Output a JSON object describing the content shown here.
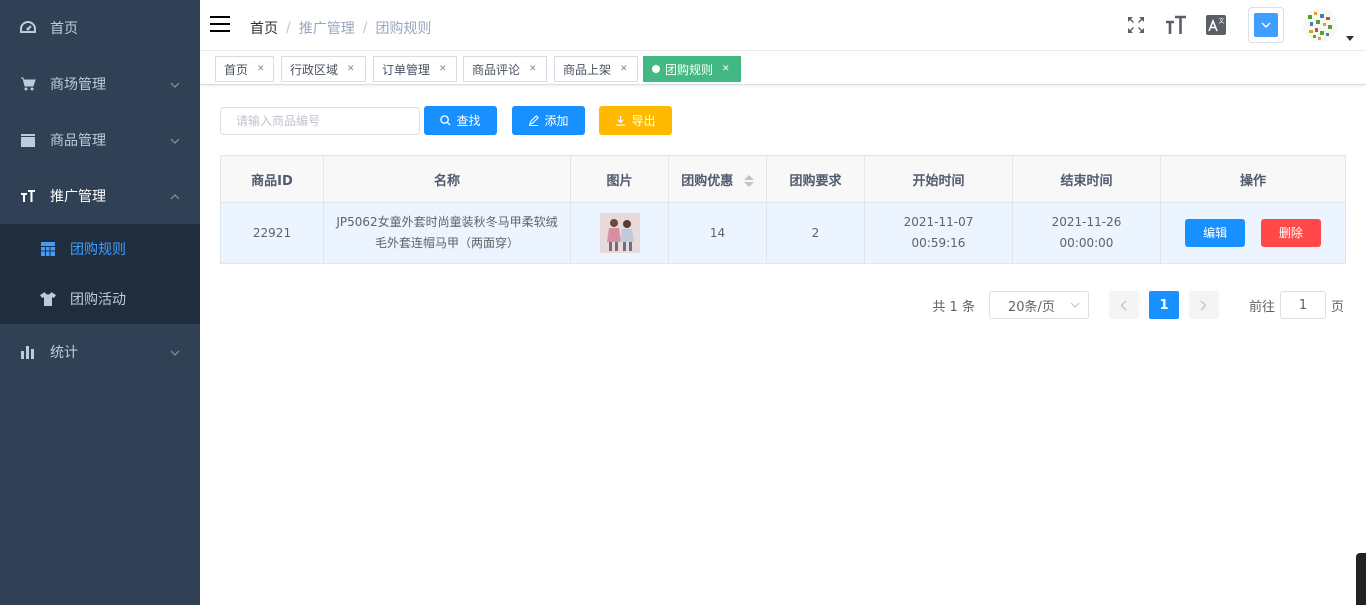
{
  "sidebar": {
    "items": [
      {
        "label": "首页",
        "icon": "dashboard-icon",
        "has_arrow": false
      },
      {
        "label": "商场管理",
        "icon": "cart-icon",
        "has_arrow": true
      },
      {
        "label": "商品管理",
        "icon": "clapperboard-icon",
        "has_arrow": true
      },
      {
        "label": "推广管理",
        "icon": "font-size-icon",
        "has_arrow": true,
        "expanded": true
      },
      {
        "label": "统计",
        "icon": "bar-chart-icon",
        "has_arrow": true
      }
    ],
    "submenu": [
      {
        "label": "团购规则",
        "icon": "table-icon",
        "active": true
      },
      {
        "label": "团购活动",
        "icon": "shirt-icon",
        "active": false
      }
    ]
  },
  "breadcrumb": [
    "首页",
    "推广管理",
    "团购规则"
  ],
  "tags": [
    {
      "label": "首页",
      "active": false
    },
    {
      "label": "行政区域",
      "active": false
    },
    {
      "label": "订单管理",
      "active": false
    },
    {
      "label": "商品评论",
      "active": false
    },
    {
      "label": "商品上架",
      "active": false
    },
    {
      "label": "团购规则",
      "active": true
    }
  ],
  "toolbar": {
    "search_placeholder": "请输入商品编号",
    "search_label": "查找",
    "add_label": "添加",
    "export_label": "导出"
  },
  "table": {
    "columns": [
      "商品ID",
      "名称",
      "图片",
      "团购优惠",
      "团购要求",
      "开始时间",
      "结束时间",
      "操作"
    ],
    "rows": [
      {
        "goods_id": "22921",
        "name": "JP5062女童外套时尚童装秋冬马甲柔软绒毛外套连帽马甲（两面穿）",
        "discount": "14",
        "requirement": "2",
        "start_time": "2021-11-07 00:59:16",
        "end_time": "2021-11-26 00:00:00",
        "edit_label": "编辑",
        "delete_label": "删除"
      }
    ]
  },
  "pagination": {
    "total_text": "共 1 条",
    "page_size": "20条/页",
    "current_page": "1",
    "goto_label": "前往",
    "goto_value": "1",
    "page_suffix": "页"
  },
  "colors": {
    "sidebar_bg": "#304156",
    "primary": "#1890ff",
    "warning": "#ffba00",
    "danger": "#ff4949",
    "active_tag": "#42b983"
  }
}
